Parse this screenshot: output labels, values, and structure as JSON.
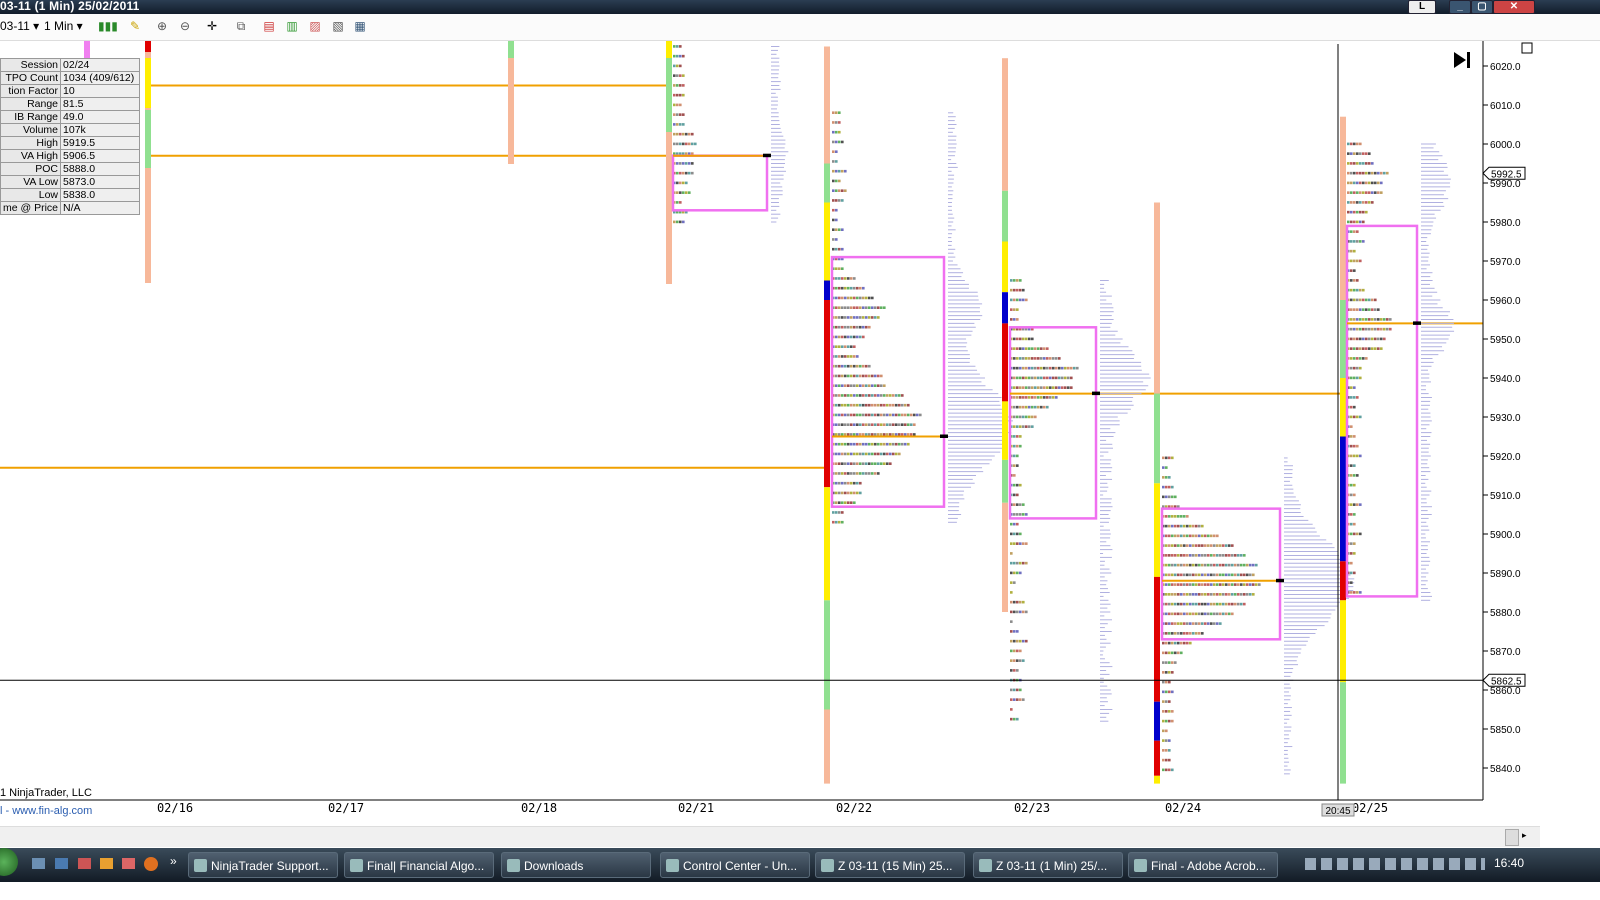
{
  "window": {
    "title": "03-11 (1 Min)  25/02/2011",
    "controls": [
      "_",
      "▢",
      "✕"
    ]
  },
  "toolbar": {
    "instrument": "03-11",
    "interval": "1 Min"
  },
  "info": {
    "rows": [
      {
        "k": "Session",
        "v": "02/24"
      },
      {
        "k": "TPO Count",
        "v": "1034 (409/612)"
      },
      {
        "k": "tion Factor",
        "v": "10"
      },
      {
        "k": "Range",
        "v": "81.5"
      },
      {
        "k": "IB Range",
        "v": "49.0"
      },
      {
        "k": "Volume",
        "v": "107k"
      },
      {
        "k": "High",
        "v": "5919.5"
      },
      {
        "k": "VA High",
        "v": "5906.5"
      },
      {
        "k": "POC",
        "v": "5888.0"
      },
      {
        "k": "VA Low",
        "v": "5873.0"
      },
      {
        "k": "Low",
        "v": "5838.0"
      },
      {
        "k": "me @ Price",
        "v": "N/A"
      }
    ]
  },
  "chart_data": {
    "type": "market-profile",
    "price_axis": {
      "ticks": [
        "6020.0",
        "6010.0",
        "6000.0",
        "5990.0",
        "5980.0",
        "5970.0",
        "5960.0",
        "5950.0",
        "5940.0",
        "5930.0",
        "5920.0",
        "5910.0",
        "5900.0",
        "5890.0",
        "5880.0",
        "5870.0",
        "5860.0",
        "5850.0",
        "5840.0"
      ],
      "range": [
        5836,
        6025
      ],
      "last_price": "5992.5",
      "cursor_price": "5862.5"
    },
    "dates": [
      "02/16",
      "02/17",
      "02/18",
      "02/21",
      "02/22",
      "02/23",
      "02/24",
      "02/25"
    ],
    "cursor_time": "20:45",
    "sessions": [
      {
        "date": "02/21",
        "high": 6025,
        "low": 5980,
        "va_high": 5997,
        "va_low": 5983,
        "poc": 5997
      },
      {
        "date": "02/22",
        "high": 6008,
        "low": 5903,
        "va_high": 5971,
        "va_low": 5907,
        "poc": 5925
      },
      {
        "date": "02/23",
        "high": 5965,
        "low": 5852,
        "va_high": 5953,
        "va_low": 5904,
        "poc": 5936
      },
      {
        "date": "02/24",
        "high": 5919.5,
        "low": 5838,
        "va_high": 5906.5,
        "va_low": 5873,
        "poc": 5888
      },
      {
        "date": "02/25",
        "high": 6000,
        "low": 5883,
        "va_high": 5979,
        "va_low": 5884,
        "poc": 5954
      }
    ],
    "colors": {
      "poc_line": "#f0a000",
      "value_area": "#f070f0",
      "volume_profile": "#b0b0e0"
    }
  },
  "footer": {
    "copyright": "1 NinjaTrader, LLC",
    "website": "l - www.fin-alg.com"
  },
  "taskbar": {
    "items": [
      "NinjaTrader Support...",
      "Final| Financial Algo...",
      "Downloads",
      "Control Center - Un...",
      "Z 03-11 (15 Min)  25...",
      "Z 03-11 (1 Min)  25/...",
      "Final - Adobe Acrob..."
    ],
    "clock": "16:40"
  }
}
